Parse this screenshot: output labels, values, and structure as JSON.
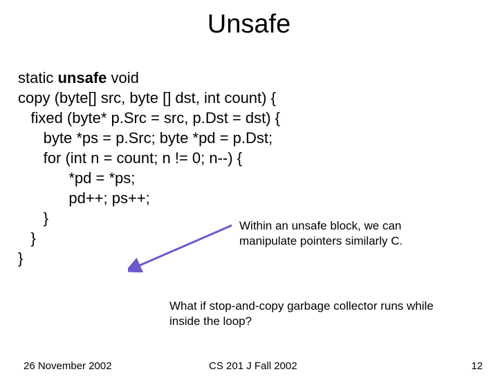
{
  "title": "Unsafe",
  "code": {
    "l1a": "static ",
    "l1b": "unsafe ",
    "l1c": "void",
    "l2": "copy (byte[] src, byte [] dst, int count) {",
    "l3": "   fixed (byte* p.Src = src, p.Dst = dst) {",
    "l4": "      byte *ps = p.Src; byte *pd = p.Dst;",
    "l5": "      for (int n = count; n != 0; n--) {",
    "l6": "            *pd = *ps;",
    "l7": "            pd++; ps++;",
    "l8": "      }",
    "l9": "   }",
    "l10": "}"
  },
  "note1": "Within an unsafe block, we can manipulate pointers similarly C.",
  "note2": "What if stop-and-copy garbage collector runs while inside the loop?",
  "footer": {
    "date": "26 November 2002",
    "course": "CS 201 J Fall 2002",
    "page": "12"
  },
  "arrow_color": "#6a5acd"
}
